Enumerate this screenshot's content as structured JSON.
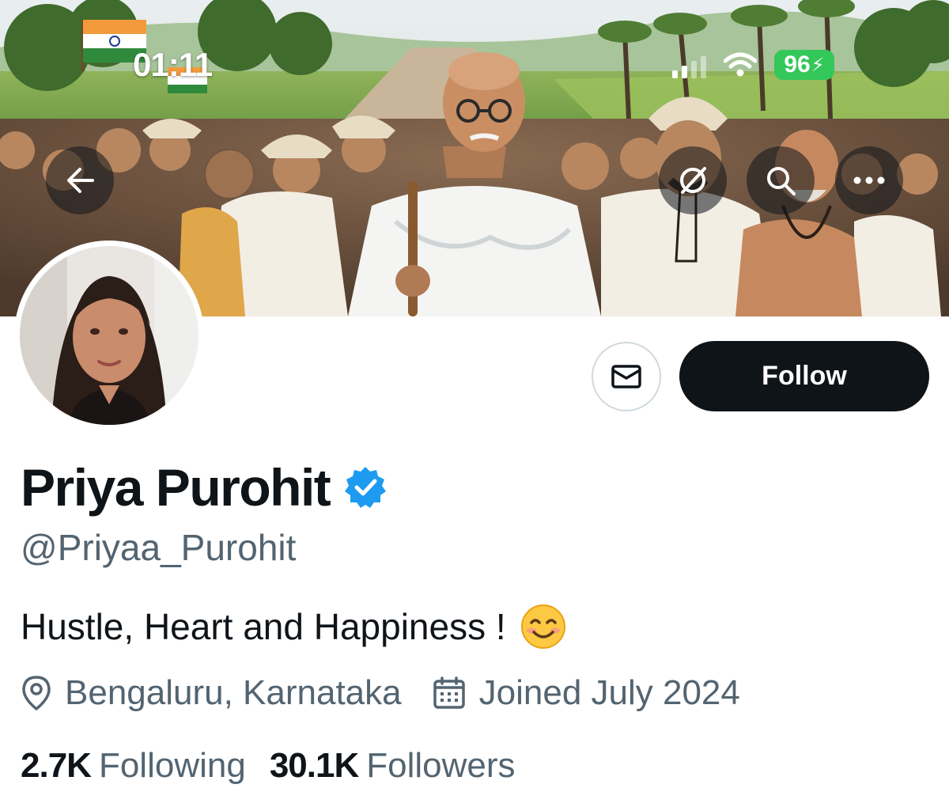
{
  "status_bar": {
    "time": "01:11",
    "battery_level": "96",
    "battery_icon": "charging-bolt-icon",
    "battery_color": "#34c759",
    "signal_icon": "cellular-signal-icon",
    "wifi_icon": "wifi-icon"
  },
  "banner_actions": {
    "back_icon": "arrow-left-icon",
    "grok_icon": "grok-icon",
    "search_icon": "search-icon",
    "more_icon": "more-horizontal-icon"
  },
  "profile": {
    "display_name": "Priya Purohit",
    "verified": true,
    "verified_color": "#1d9bf0",
    "handle": "@Priyaa_Purohit",
    "bio": "Hustle, Heart and Happiness !",
    "bio_emoji": "smiling-face-icon",
    "location": "Bengaluru, Karnataka",
    "joined": "Joined July 2024"
  },
  "actions": {
    "message_icon": "envelope-icon",
    "follow_label": "Follow"
  },
  "stats": {
    "following_count": "2.7K",
    "following_label": "Following",
    "followers_count": "30.1K",
    "followers_label": "Followers"
  },
  "colors": {
    "primary_text": "#0f1419",
    "secondary_text": "#536471",
    "follow_button_bg": "#0f1419"
  }
}
